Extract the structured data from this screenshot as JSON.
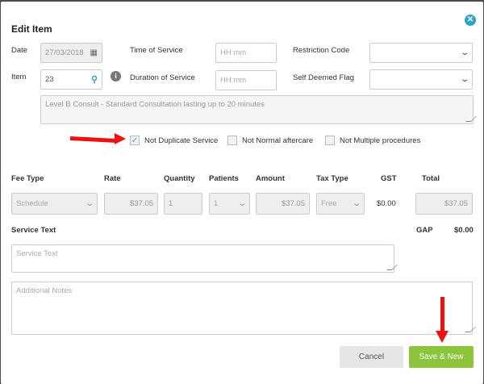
{
  "dialog": {
    "title": "Edit Item"
  },
  "fields": {
    "date_label": "Date",
    "date_value": "27/03/2018",
    "item_label": "Item",
    "item_value": "23",
    "time_label": "Time of Service",
    "time_placeholder": "HH:mm",
    "duration_label": "Duration of Service",
    "duration_placeholder": "HH:mm",
    "restriction_label": "Restriction Code",
    "self_deemed_label": "Self Deemed Flag",
    "description": "Level B Consult - Standard Consultation lasting up to 20 minutes"
  },
  "checkboxes": [
    {
      "label": "Not Duplicate Service",
      "checked": true
    },
    {
      "label": "Not Normal aftercare",
      "checked": false
    },
    {
      "label": "Not Multiple procedures",
      "checked": false
    }
  ],
  "fee_table": {
    "headers": [
      "Fee Type",
      "Rate",
      "Quantity",
      "Patients",
      "Amount",
      "Tax Type",
      "GST",
      "Total"
    ],
    "fee_type": "Schedule",
    "rate": "$37.05",
    "quantity": "1",
    "patients": "1",
    "amount": "$37.05",
    "tax_type": "Free",
    "gst": "$0.00",
    "total": "$37.05"
  },
  "service_text": {
    "label": "Service Text",
    "placeholder": "Service Text"
  },
  "gap": {
    "label": "GAP",
    "value": "$0.00"
  },
  "notes": {
    "placeholder": "Additional Notes"
  },
  "buttons": {
    "cancel": "Cancel",
    "save_new": "Save & New"
  },
  "colors": {
    "accent": "#2fa4c9",
    "save_button": "#8cc43c",
    "arrow": "#e11111"
  },
  "icons": {
    "calendar": "calendar-icon",
    "search": "search-icon",
    "info": "info-icon",
    "close": "close-icon"
  }
}
